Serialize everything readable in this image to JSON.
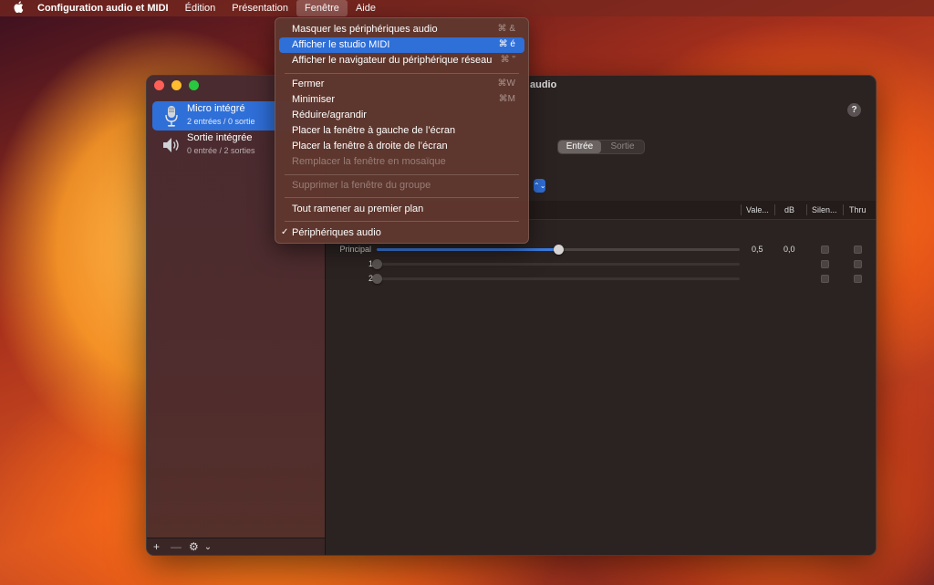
{
  "menubar": {
    "apple_icon": "apple-logo-icon",
    "app_name": "Configuration audio et MIDI",
    "items": [
      "Édition",
      "Présentation",
      "Fenêtre",
      "Aide"
    ],
    "active": "Fenêtre"
  },
  "window": {
    "title_fragment": "audio",
    "devices": [
      {
        "name": "Micro intégré",
        "sub": "2 entrées / 0 sortie",
        "icon": "microphone-icon",
        "selected": true
      },
      {
        "name": "Sortie intégrée",
        "sub": "0 entrée / 2 sorties",
        "icon": "speaker-icon",
        "selected": false
      }
    ],
    "footer": {
      "add": "+",
      "remove": "—",
      "gear": "⚙",
      "chevron": "⌄"
    },
    "help": "?",
    "tabs": [
      "Entrée",
      "Sortie"
    ],
    "active_tab": "Entrée",
    "stepper": "⌃⌄",
    "columns": [
      "Vale...",
      "dB",
      "Silen...",
      "Thru"
    ],
    "channels": [
      {
        "label": "Principal",
        "value": "0,5",
        "db": "0,0",
        "level": 0.5,
        "enabled": true
      },
      {
        "label": "1",
        "value": "",
        "db": "",
        "level": 0,
        "enabled": false
      },
      {
        "label": "2",
        "value": "",
        "db": "",
        "level": 0,
        "enabled": false
      }
    ]
  },
  "menu": {
    "items": [
      {
        "label": "Masquer les périphériques audio",
        "shortcut": "⌘ &"
      },
      {
        "label": "Afficher le studio MIDI",
        "shortcut": "⌘ é",
        "highlighted": true
      },
      {
        "label": "Afficher le navigateur du périphérique réseau",
        "shortcut": "⌘ \""
      },
      {
        "label": "Fermer",
        "shortcut": "⌘W"
      },
      {
        "label": "Minimiser",
        "shortcut": "⌘M"
      },
      {
        "label": "Réduire/agrandir",
        "shortcut": ""
      },
      {
        "label": "Placer la fenêtre à gauche de l’écran",
        "shortcut": ""
      },
      {
        "label": "Placer la fenêtre à droite de l’écran",
        "shortcut": ""
      },
      {
        "label": "Remplacer la fenêtre en mosaïque",
        "shortcut": "",
        "disabled": true
      },
      {
        "label": "Supprimer la fenêtre du groupe",
        "shortcut": "",
        "disabled": true
      },
      {
        "label": "Tout ramener au premier plan",
        "shortcut": ""
      },
      {
        "label": "Périphériques audio",
        "shortcut": "",
        "checked": true,
        "check": "✓"
      }
    ]
  }
}
